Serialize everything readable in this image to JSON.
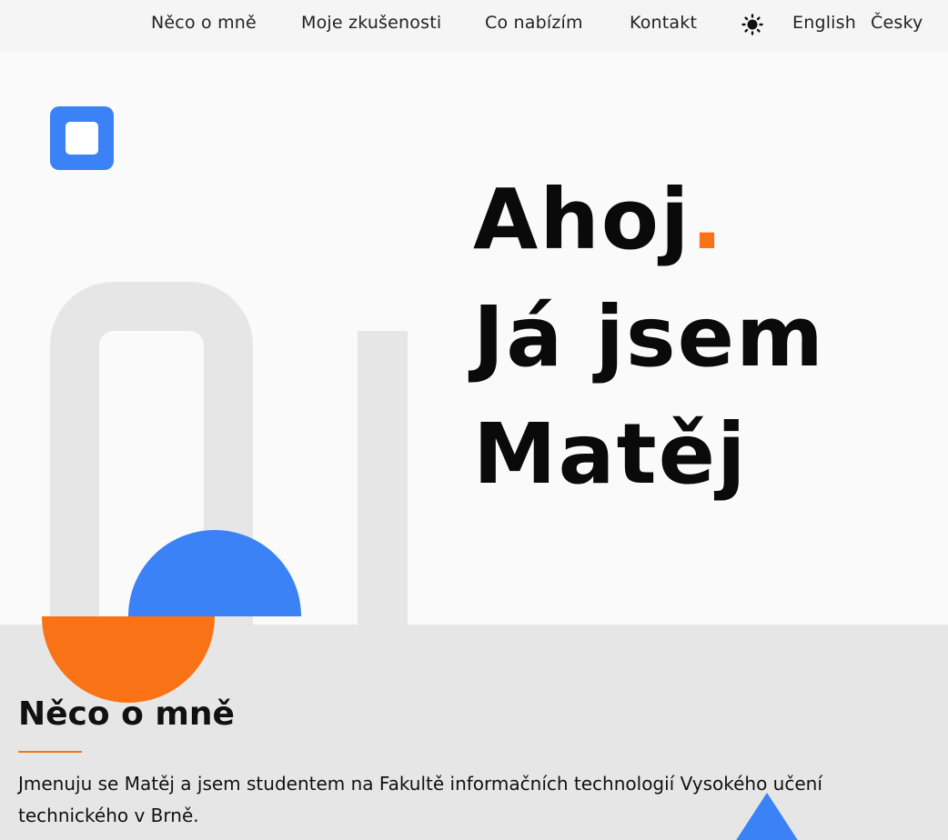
{
  "nav": {
    "about": "Něco o mně",
    "experience": "Moje zkušenosti",
    "offer": "Co nabízím",
    "contact": "Kontakt",
    "theme_icon": "sun-icon",
    "lang_en": "English",
    "lang_cs": "Česky"
  },
  "hero": {
    "line1": "Ahoj",
    "line1_dot": ".",
    "line2": "Já jsem",
    "line3": "Matěj"
  },
  "about": {
    "heading": "Něco o mně",
    "text": "Jmenuju se Matěj a jsem studentem na Fakultě informačních technologií Vysokého učení technického v Brně."
  },
  "colors": {
    "accent_blue": "#3b82f6",
    "accent_orange": "#f97316"
  }
}
